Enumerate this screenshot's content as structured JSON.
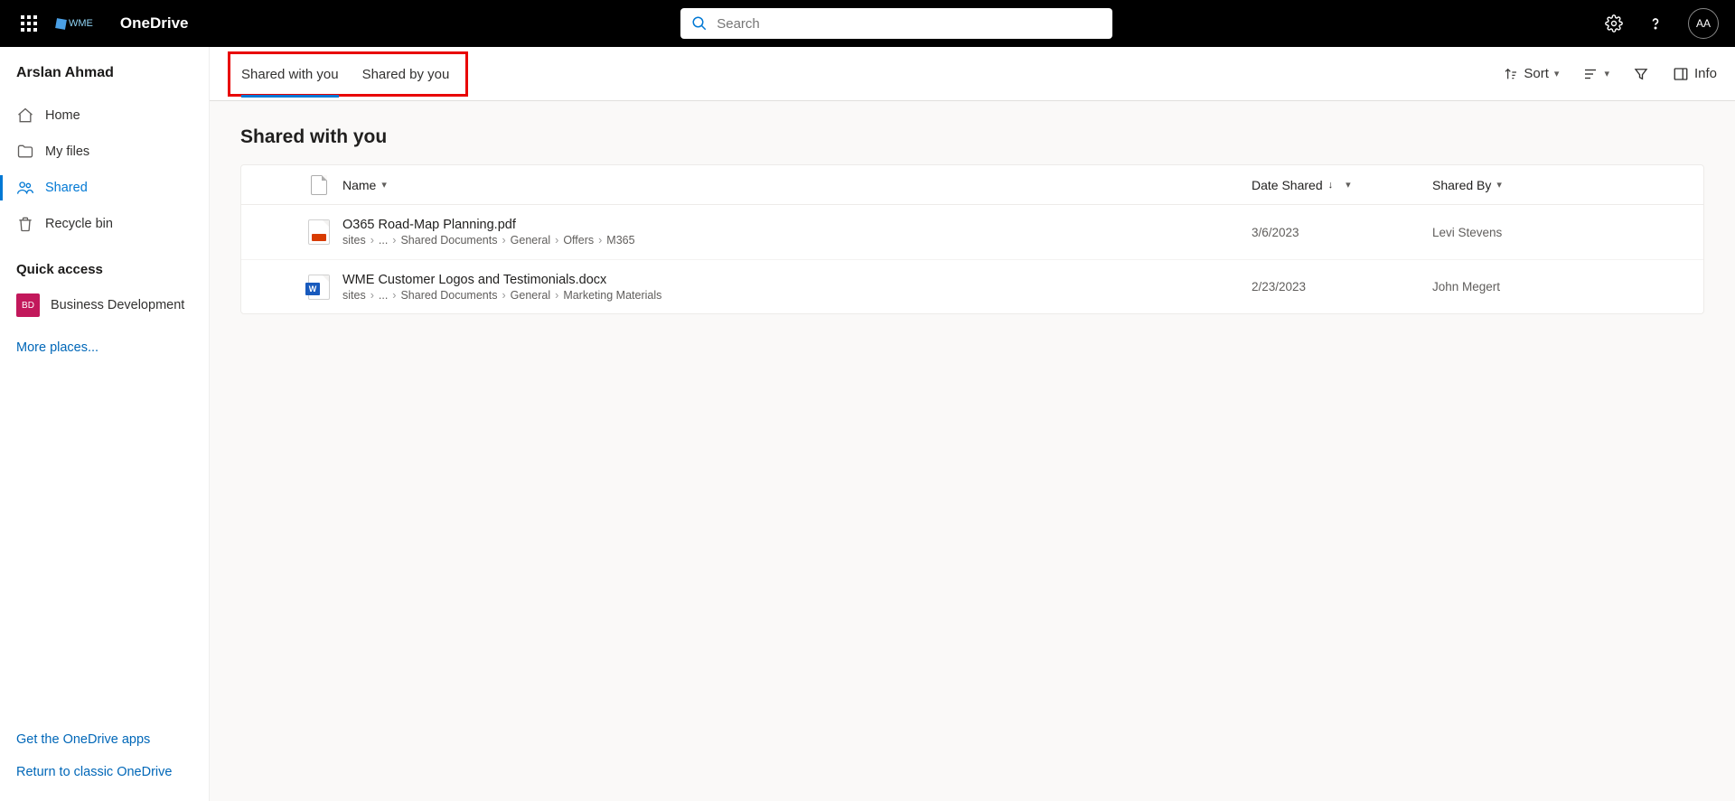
{
  "header": {
    "tenant_logo_text": "WME",
    "app_name": "OneDrive",
    "search_placeholder": "Search",
    "avatar_initials": "AA"
  },
  "sidebar": {
    "user_name": "Arslan Ahmad",
    "nav": [
      {
        "label": "Home",
        "icon": "home"
      },
      {
        "label": "My files",
        "icon": "folder"
      },
      {
        "label": "Shared",
        "icon": "people",
        "active": true
      },
      {
        "label": "Recycle bin",
        "icon": "trash"
      }
    ],
    "quick_access_title": "Quick access",
    "quick_access": [
      {
        "label": "Business Development",
        "badge": "BD"
      }
    ],
    "more_places": "More places...",
    "bottom_links": [
      "Get the OneDrive apps",
      "Return to classic OneDrive"
    ]
  },
  "tabs": {
    "items": [
      {
        "label": "Shared with you",
        "active": true
      },
      {
        "label": "Shared by you",
        "active": false
      }
    ]
  },
  "toolbar": {
    "sort": "Sort",
    "info": "Info"
  },
  "page_title": "Shared with you",
  "columns": {
    "name": "Name",
    "date_shared": "Date Shared",
    "shared_by": "Shared By"
  },
  "files": [
    {
      "type": "pdf",
      "name": "O365 Road-Map Planning.pdf",
      "path": [
        "sites",
        "...",
        "Shared Documents",
        "General",
        "Offers",
        "M365"
      ],
      "date_shared": "3/6/2023",
      "shared_by": "Levi Stevens"
    },
    {
      "type": "docx",
      "name": "WME Customer Logos and Testimonials.docx",
      "path": [
        "sites",
        "...",
        "Shared Documents",
        "General",
        "Marketing Materials"
      ],
      "date_shared": "2/23/2023",
      "shared_by": "John Megert"
    }
  ]
}
